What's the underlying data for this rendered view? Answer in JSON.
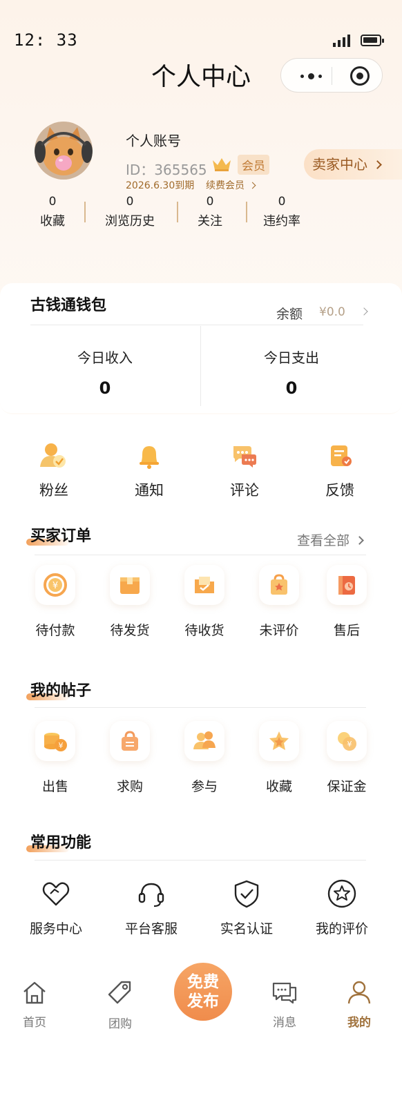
{
  "status_bar": {
    "time": "12: 33"
  },
  "header": {
    "title": "个人中心"
  },
  "profile": {
    "account_name": "个人账号",
    "id_text": "ID：365565",
    "vip_label": "会员",
    "expiry": "2026.6.30到期",
    "renew_label": "续费会员",
    "seller_center": "卖家中心"
  },
  "stats": [
    {
      "value": "0",
      "label": "收藏"
    },
    {
      "value": "0",
      "label": "浏览历史"
    },
    {
      "value": "0",
      "label": "关注"
    },
    {
      "value": "0",
      "label": "违约率"
    }
  ],
  "wallet": {
    "title": "古钱通钱包",
    "balance_label": "余额",
    "balance_value": "¥0.0",
    "income_label": "今日收入",
    "income_value": "0",
    "expense_label": "今日支出",
    "expense_value": "0"
  },
  "quick_actions": [
    {
      "label": "粉丝",
      "icon": "fans-icon"
    },
    {
      "label": "通知",
      "icon": "bell-icon"
    },
    {
      "label": "评论",
      "icon": "comment-icon"
    },
    {
      "label": "反馈",
      "icon": "feedback-icon"
    }
  ],
  "buyer_orders": {
    "title": "买家订单",
    "view_all": "查看全部",
    "items": [
      {
        "label": "待付款",
        "icon": "pending-payment-icon"
      },
      {
        "label": "待发货",
        "icon": "pending-shipment-icon"
      },
      {
        "label": "待收货",
        "icon": "pending-receipt-icon"
      },
      {
        "label": "未评价",
        "icon": "unrated-icon"
      },
      {
        "label": "售后",
        "icon": "after-sales-icon"
      }
    ]
  },
  "my_posts": {
    "title": "我的帖子",
    "items": [
      {
        "label": "出售",
        "icon": "sell-icon"
      },
      {
        "label": "求购",
        "icon": "buy-request-icon"
      },
      {
        "label": "参与",
        "icon": "participate-icon"
      },
      {
        "label": "收藏",
        "icon": "favorite-icon"
      },
      {
        "label": "保证金",
        "icon": "deposit-icon"
      }
    ]
  },
  "common_functions": {
    "title": "常用功能",
    "items": [
      {
        "label": "服务中心",
        "icon": "heart-hand-icon"
      },
      {
        "label": "平台客服",
        "icon": "headset-icon"
      },
      {
        "label": "实名认证",
        "icon": "shield-check-icon"
      },
      {
        "label": "我的评价",
        "icon": "star-circle-icon"
      }
    ]
  },
  "tabbar": {
    "items": [
      {
        "label": "首页",
        "icon": "home-icon"
      },
      {
        "label": "团购",
        "icon": "tag-icon"
      },
      {
        "label": "消息",
        "icon": "message-icon"
      },
      {
        "label": "我的",
        "icon": "user-icon",
        "active": true
      }
    ],
    "publish_line1": "免费",
    "publish_line2": "发布"
  },
  "colors": {
    "accent": "#f08c4c",
    "brand_brown": "#a0723c",
    "header_bg": "#fdf3ea"
  }
}
